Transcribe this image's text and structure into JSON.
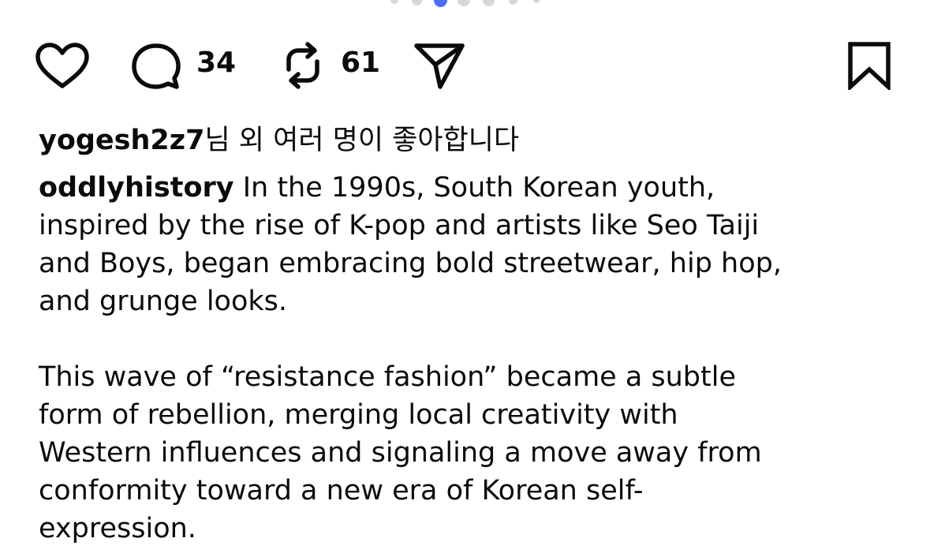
{
  "carousel": {
    "active_index": 2,
    "count": 6
  },
  "actions": {
    "comment_count": "34",
    "repost_count": "61",
    "icons": [
      "heart-icon",
      "comment-icon",
      "repost-icon",
      "send-icon",
      "bookmark-icon"
    ]
  },
  "likes": {
    "username": "yogesh2z7",
    "suffix": "님 외 여러 명이 좋아합니다"
  },
  "caption": {
    "username": "oddlyhistory",
    "paragraph1_lines": [
      " In the 1990s, South Korean youth,",
      "inspired by the rise of K-pop and artists like Seo Taiji",
      "and Boys, began embracing bold streetwear, hip hop,",
      "and grunge looks."
    ],
    "paragraph2_lines": [
      "This wave of “resistance fashion” became a subtle",
      "form of rebellion, merging local creativity with",
      "Western influences and signaling a move away from",
      "conformity toward a new era of Korean self-",
      "expression."
    ]
  },
  "colors": {
    "text": "#0b0b0b",
    "dot_active": "#4f6ef7",
    "dot_inactive": "#d7d7d7"
  }
}
